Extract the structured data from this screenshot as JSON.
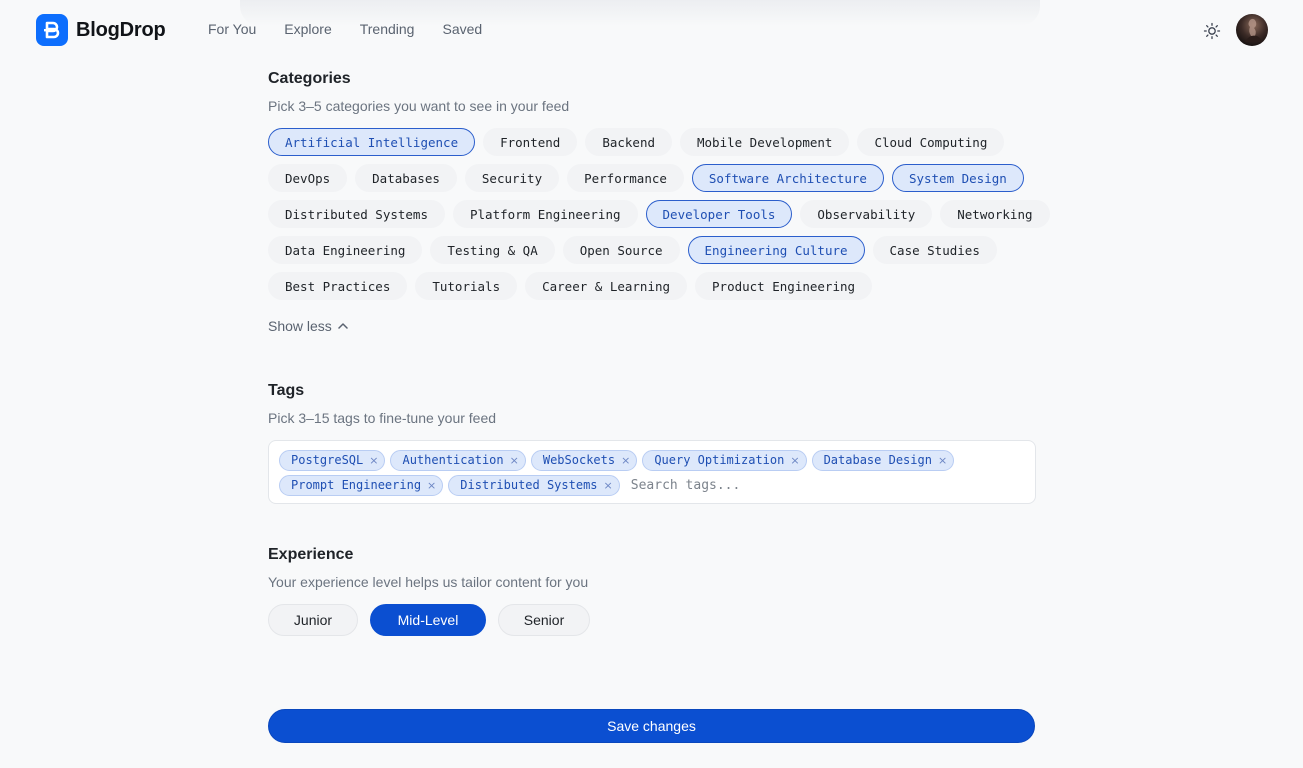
{
  "app": {
    "name": "BlogDrop",
    "nav": [
      "For You",
      "Explore",
      "Trending",
      "Saved"
    ],
    "icons": {
      "logo": "blogdrop-logo-icon",
      "theme": "sun-icon",
      "avatar": "avatar"
    },
    "accent": "#0b4fd1"
  },
  "categories": {
    "title": "Categories",
    "subtitle": "Pick 3–5 categories you want to see in your feed",
    "rows": [
      [
        {
          "label": "Artificial Intelligence",
          "selected": true
        },
        {
          "label": "Frontend",
          "selected": false
        },
        {
          "label": "Backend",
          "selected": false
        },
        {
          "label": "Mobile Development",
          "selected": false
        },
        {
          "label": "Cloud Computing",
          "selected": false
        }
      ],
      [
        {
          "label": "DevOps",
          "selected": false
        },
        {
          "label": "Databases",
          "selected": false
        },
        {
          "label": "Security",
          "selected": false
        },
        {
          "label": "Performance",
          "selected": false
        },
        {
          "label": "Software Architecture",
          "selected": true
        },
        {
          "label": "System Design",
          "selected": true
        }
      ],
      [
        {
          "label": "Distributed Systems",
          "selected": false
        },
        {
          "label": "Platform Engineering",
          "selected": false
        },
        {
          "label": "Developer Tools",
          "selected": true
        },
        {
          "label": "Observability",
          "selected": false
        },
        {
          "label": "Networking",
          "selected": false
        }
      ],
      [
        {
          "label": "Data Engineering",
          "selected": false
        },
        {
          "label": "Testing & QA",
          "selected": false
        },
        {
          "label": "Open Source",
          "selected": false
        },
        {
          "label": "Engineering Culture",
          "selected": true
        },
        {
          "label": "Case Studies",
          "selected": false
        }
      ],
      [
        {
          "label": "Best Practices",
          "selected": false
        },
        {
          "label": "Tutorials",
          "selected": false
        },
        {
          "label": "Career & Learning",
          "selected": false
        },
        {
          "label": "Product Engineering",
          "selected": false
        }
      ]
    ],
    "show_less": "Show less"
  },
  "tags": {
    "title": "Tags",
    "subtitle": "Pick 3–15 tags to fine-tune your feed",
    "rows": [
      [
        "PostgreSQL",
        "Authentication",
        "WebSockets",
        "Query Optimization",
        "Database Design"
      ],
      [
        "Prompt Engineering",
        "Distributed Systems"
      ]
    ],
    "remove_glyph": "×",
    "search_placeholder": "Search tags...",
    "search_value": ""
  },
  "experience": {
    "title": "Experience",
    "subtitle": "Your experience level helps us tailor content for you",
    "options": [
      "Junior",
      "Mid-Level",
      "Senior"
    ],
    "selected": "Mid-Level"
  },
  "save_label": "Save changes"
}
